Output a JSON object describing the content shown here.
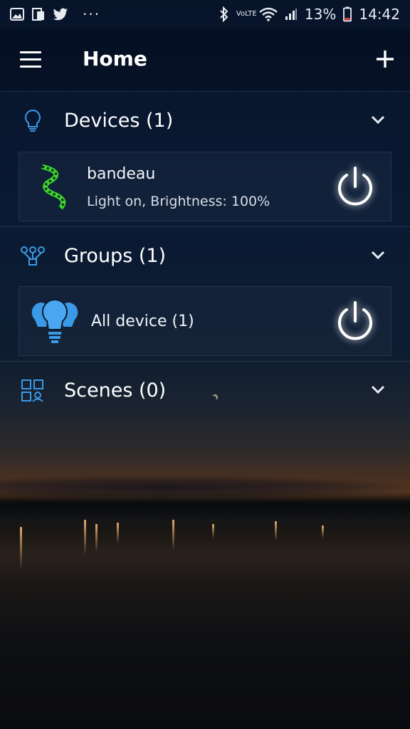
{
  "status_bar": {
    "battery_percent": "13%",
    "time": "14:42",
    "more": "···",
    "network": "VoLTE"
  },
  "app_bar": {
    "title": "Home"
  },
  "sections": {
    "devices": {
      "label": "Devices (1)"
    },
    "groups": {
      "label": "Groups (1)"
    },
    "scenes": {
      "label": "Scenes (0)"
    }
  },
  "devices": [
    {
      "name": "bandeau",
      "status": "Light on, Brightness: 100%",
      "icon": "led-strip-icon"
    }
  ],
  "groups": [
    {
      "name": "All device (1)",
      "icon": "bulb-group-icon"
    }
  ],
  "colors": {
    "accent": "#3a9ae8",
    "strip_green": "#3bd42a",
    "text": "#ffffff"
  }
}
